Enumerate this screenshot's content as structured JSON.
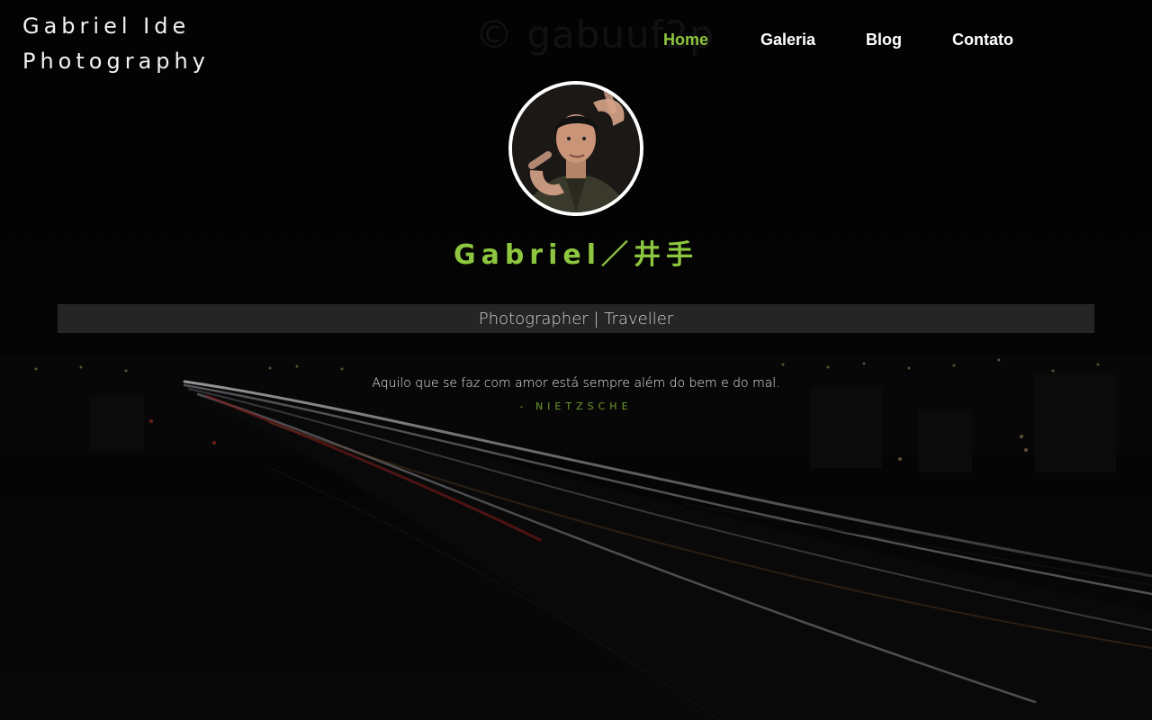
{
  "brand": {
    "line1": "Gabriel Ide",
    "line2": "Photography"
  },
  "watermark": "©  gabuuf2p",
  "nav": {
    "items": [
      {
        "label": "Home",
        "active": true
      },
      {
        "label": "Galeria",
        "active": false
      },
      {
        "label": "Blog",
        "active": false
      },
      {
        "label": "Contato",
        "active": false
      }
    ]
  },
  "profile": {
    "name": "Gabriel／井手",
    "tagline": "Photographer | Traveller"
  },
  "quote": {
    "text": "Aquilo que se faz com amor está sempre além do bem e do mal.",
    "author": "- NIETZSCHE"
  },
  "colors": {
    "accent": "#8dc63f",
    "background": "#050505",
    "nav_text": "#ffffff"
  }
}
